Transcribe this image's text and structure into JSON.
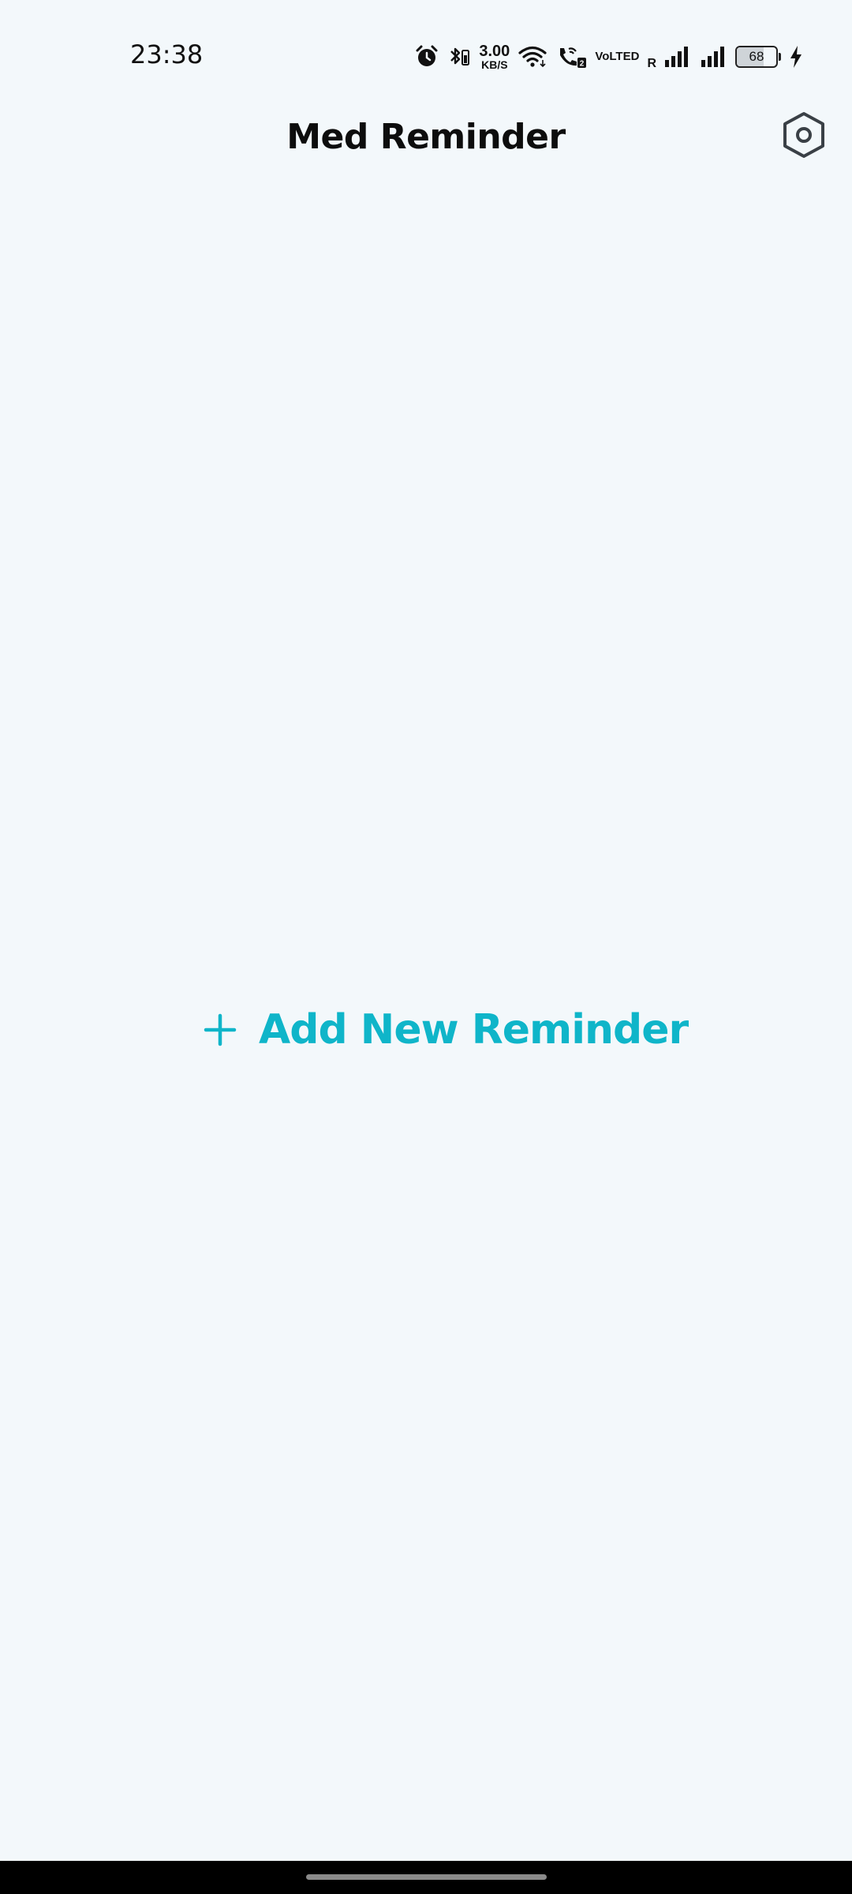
{
  "status_bar": {
    "time": "23:38",
    "net_speed_value": "3.00",
    "net_speed_unit": "KB/S",
    "volte_line1": "Vo",
    "volte_line2": "LTED",
    "roaming": "R",
    "battery_level": "68",
    "icons": [
      "alarm-icon",
      "bluetooth-battery-icon",
      "wifi-icon",
      "wifi-call-icon",
      "signal-icon",
      "signal-icon",
      "charging-icon"
    ]
  },
  "app_bar": {
    "title": "Med Reminder",
    "settings_icon": "settings-hexagon-icon"
  },
  "main": {
    "add_button_label": "Add New Reminder",
    "add_icon": "plus-icon",
    "accent_color": "#0fb5c9"
  },
  "colors": {
    "background": "#f3f8fb",
    "nav_bar": "#000000"
  }
}
